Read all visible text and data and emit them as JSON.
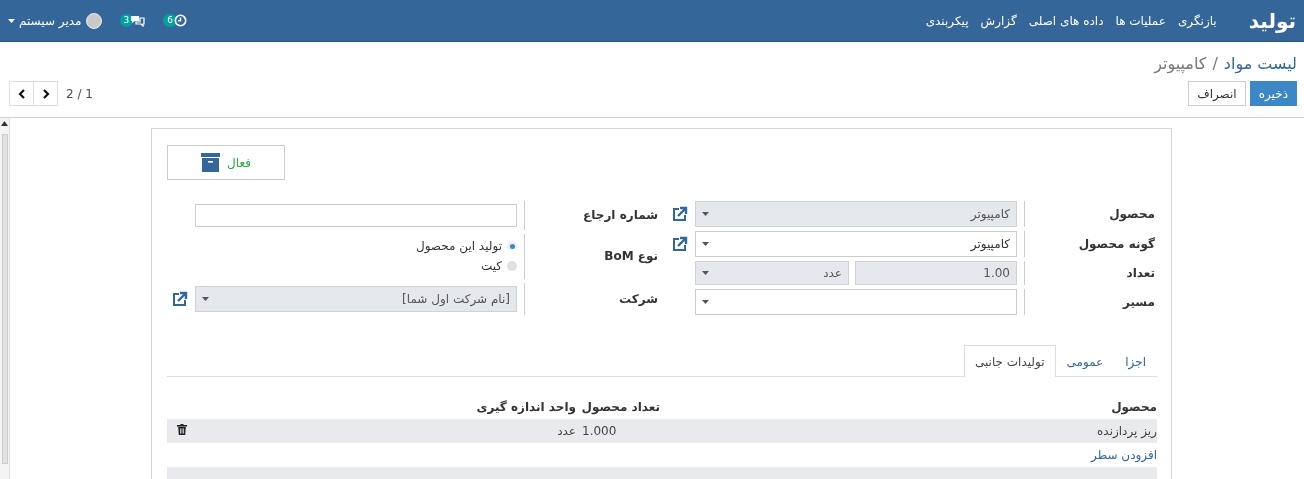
{
  "navbar": {
    "brand": "تولید",
    "menus": [
      "بازنگری",
      "عملیات ها",
      "داده های اصلی",
      "گزارش",
      "پیکربندی"
    ],
    "activity_count": "6",
    "message_count": "3",
    "user": "مدیر سیستم"
  },
  "breadcrumb": [
    {
      "label": "لیست مواد",
      "kind": "link"
    },
    {
      "label": "کامپیوتر",
      "kind": "current"
    }
  ],
  "breadcrumb_separator": "/",
  "buttons": [
    {
      "label": "ذخیره",
      "kind": "primary"
    },
    {
      "label": "انصراف",
      "kind": "secondary"
    }
  ],
  "pager": "1 / 2",
  "form": {
    "status_button": "فعال",
    "main_fields": [
      {
        "label": "محصول",
        "kind": "many2one",
        "value": "کامپیوتر",
        "readonly": true,
        "external_link": true
      },
      {
        "label": "گونه محصول",
        "kind": "many2one",
        "value": "کامپیوتر",
        "readonly": false,
        "external_link": true
      },
      {
        "label": "تعداد",
        "kind": "quantity",
        "value": "1.00",
        "unit": "عدد",
        "readonly": true
      },
      {
        "label": "مسیر",
        "kind": "many2one",
        "readonly": false,
        "external_link": false
      }
    ],
    "side_fields": [
      {
        "label": "شماره ارجاع",
        "kind": "text"
      },
      {
        "label": "نوع BoM",
        "kind": "radio",
        "options": [
          {
            "label": "تولید این محصول",
            "selected": true
          },
          {
            "label": "کیت",
            "selected": false
          }
        ]
      },
      {
        "label": "شرکت",
        "kind": "many2one",
        "value": "[نام شرکت اول شما]",
        "readonly": true,
        "external_link": true
      }
    ],
    "tabs": [
      {
        "label": "اجزا",
        "selected": false
      },
      {
        "label": "عمومی",
        "selected": false
      },
      {
        "label": "تولیدات جانبی",
        "selected": true
      }
    ],
    "table": {
      "columns": [
        "محصول",
        "تعداد محصول",
        "واحد اندازه گیری"
      ],
      "rows": [
        [
          "ریز پردازنده",
          "1.000",
          "عدد"
        ]
      ],
      "add_line": "افزودن سطر"
    }
  }
}
